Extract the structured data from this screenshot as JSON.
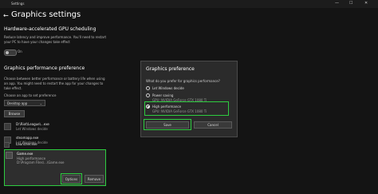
{
  "window": {
    "app_name": "Settings",
    "minimize": "—",
    "maximize": "☐",
    "close": "✕"
  },
  "header": {
    "back": "←",
    "title": "Graphics settings"
  },
  "gpu_scheduling": {
    "heading": "Hardware-accelerated GPU scheduling",
    "desc": "Reduce latency and improve performance. You'll need to restart your PC to have your changes take effect",
    "toggle_label": "On"
  },
  "preference": {
    "heading": "Graphics performance preference",
    "desc": "Choose between better performance or battery life when using an app. You might need to restart the app for your changes to take effect.",
    "choose_label": "Choose an app to set preference",
    "select_value": "Desktop app",
    "browse_label": "Browse"
  },
  "apps": [
    {
      "name": "D:\\Riot\\League\\...exe",
      "sub": "Let Windows decide"
    },
    {
      "name": "steamapp.exe",
      "sub": "Let Windows decide"
    },
    {
      "name": "Launcher.exe",
      "sub": "Let Windows decide"
    }
  ],
  "selected_app": {
    "name": "Game.exe",
    "sub1": "High performance",
    "sub2": "D:\\Program Files\\...\\Game.exe",
    "options_label": "Options",
    "remove_label": "Remove"
  },
  "dialog": {
    "title": "Graphics preference",
    "question": "What do you prefer for graphics performance?",
    "options": [
      {
        "label": "Let Windows decide",
        "sub": ""
      },
      {
        "label": "Power saving",
        "sub": "GPU: NVIDIA GeForce GTX 1080 Ti"
      },
      {
        "label": "High performance",
        "sub": "GPU: NVIDIA GeForce GTX 1080 Ti"
      }
    ],
    "save_label": "Save",
    "cancel_label": "Cancel"
  }
}
